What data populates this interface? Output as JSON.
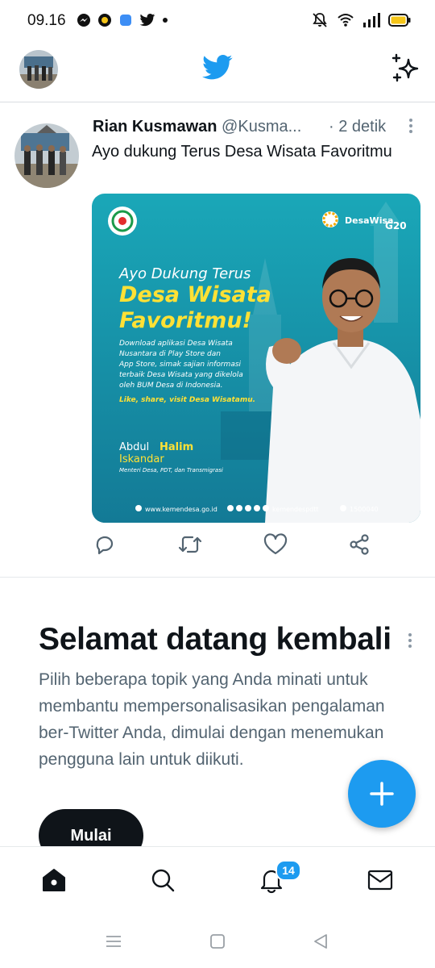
{
  "status_bar": {
    "time": "09.16",
    "battery_color": "#f5c518",
    "icons": [
      "messenger-icon",
      "app-icon",
      "blue-app-icon",
      "twitter-bird-icon",
      "dot-icon",
      "mute-icon",
      "wifi-icon",
      "signal-icon",
      "battery-icon"
    ]
  },
  "header": {
    "logo_icon": "twitter-bird-icon",
    "action_icon": "sparkle-icon"
  },
  "tweet": {
    "author_name": "Rian Kusmawan",
    "author_handle": "@Kusma...",
    "time": "· 2 detik",
    "text": "Ayo dukung Terus Desa Wisata Favoritmu",
    "image": {
      "heading_small": "Ayo Dukung Terus",
      "heading_large_1": "Desa Wisata",
      "heading_large_2": "Favoritmu!",
      "body_1": "Download aplikasi Desa Wisata",
      "body_2": "Nusantara di Play Store dan",
      "body_3": "App Store, simak sajian informasi",
      "body_4": "terbaik Desa Wisata yang dikelola",
      "body_5": "oleh BUM Desa di Indonesia.",
      "cta": "Like, share, visit Desa Wisatamu.",
      "person_first": "Abdul",
      "person_mid": "Halim",
      "person_last": "Iskandar",
      "person_title": "Menteri Desa, PDT, dan Transmigrasi",
      "footer_url": "www.kemendesa.go.id",
      "footer_social": "kemendespdtt",
      "footer_phone": "1500040",
      "logo_right_1": "DesaWisa",
      "logo_right_2": "G20"
    },
    "actions": [
      "reply-icon",
      "retweet-icon",
      "like-icon",
      "share-icon"
    ]
  },
  "welcome": {
    "title": "Selamat datang kembali",
    "body": "Pilih beberapa topik yang Anda minati untuk membantu mempersonalisasikan pengalaman ber-Twitter Anda, dimulai dengan menemukan pengguna lain untuk diikuti.",
    "button_label": "Mulai"
  },
  "fab": {
    "label": "+"
  },
  "bottom_nav": {
    "items": [
      "home-icon",
      "search-icon",
      "notifications-icon",
      "messages-icon"
    ],
    "notification_count": "14"
  },
  "system_nav": [
    "menu-icon",
    "home-square-icon",
    "back-icon"
  ],
  "colors": {
    "accent": "#1d9bf0",
    "text": "#0f1419",
    "muted": "#536471",
    "poster_bg": "#1f9bb4"
  }
}
